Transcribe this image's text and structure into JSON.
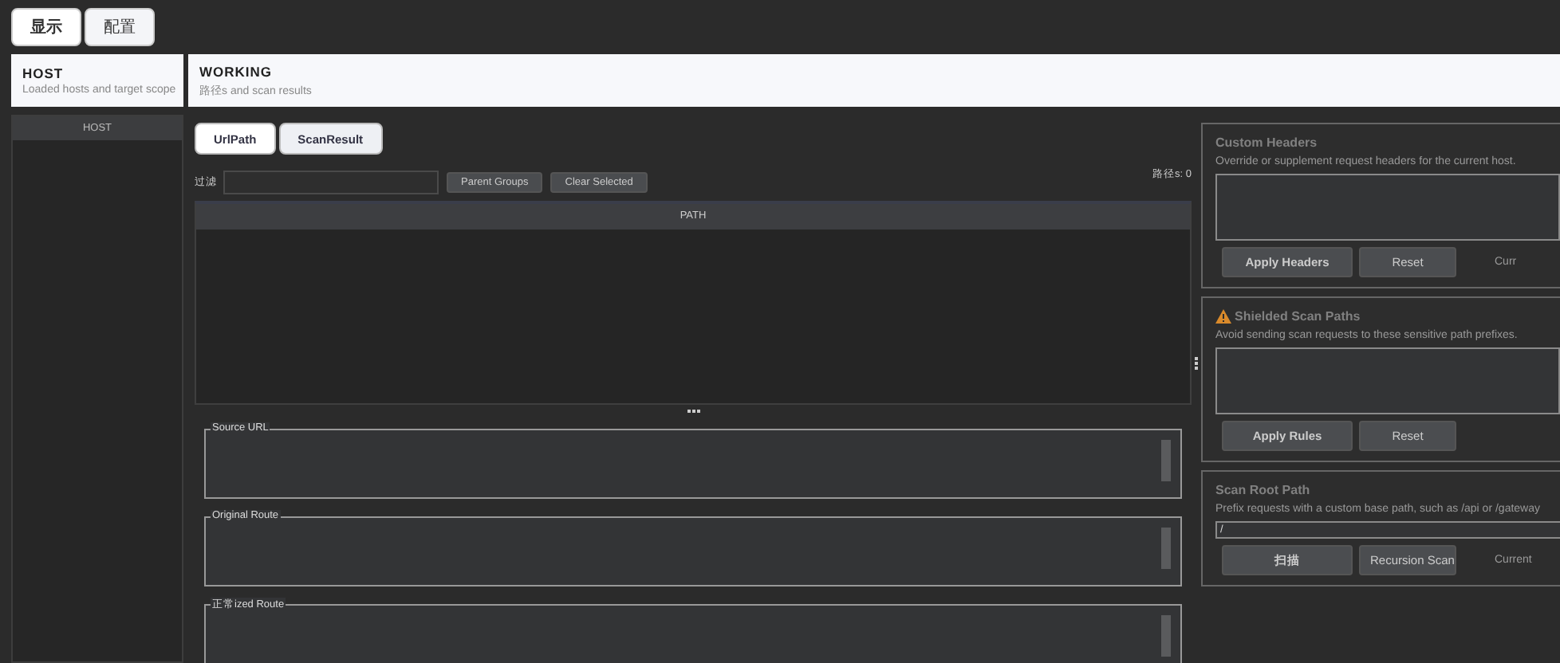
{
  "top_tabs": [
    {
      "label": "显示",
      "selected": true
    },
    {
      "label": "配置",
      "selected": false
    }
  ],
  "host_header": {
    "title": "HOST",
    "subtitle": "Loaded hosts and target scope"
  },
  "working_header": {
    "title": "WORKING",
    "subtitle": "路径s and scan results"
  },
  "host_list": {
    "column": "HOST"
  },
  "tabs": [
    {
      "label": "UrlPath",
      "selected": true
    },
    {
      "label": "ScanResult",
      "selected": false
    }
  ],
  "filter": {
    "label": "过滤",
    "buttons": [
      "Parent Groups",
      "Clear Selected"
    ],
    "count": "路径s: 0"
  },
  "path_table": {
    "columns": [
      "PATH"
    ]
  },
  "detail_fields": [
    "Source URL",
    "Original Route",
    "正常ized Route"
  ],
  "panels": [
    {
      "title": "Custom Headers",
      "warning": false,
      "description": "Override or supplement request headers for the current host.",
      "kind": "area",
      "buttons": [
        "Apply Headers",
        "Reset"
      ],
      "note": "Curr"
    },
    {
      "title": "Shielded Scan Paths",
      "warning": true,
      "description": "Avoid sending scan requests to these sensitive path prefixes.",
      "kind": "area",
      "buttons": [
        "Apply Rules",
        "Reset"
      ]
    },
    {
      "title": "Scan Root Path",
      "warning": false,
      "description": "Prefix requests with a custom base path, such as /api or /gateway",
      "kind": "line",
      "value": "/",
      "buttons": [
        "扫描",
        "Recursion Scan"
      ],
      "note": "Current"
    }
  ]
}
